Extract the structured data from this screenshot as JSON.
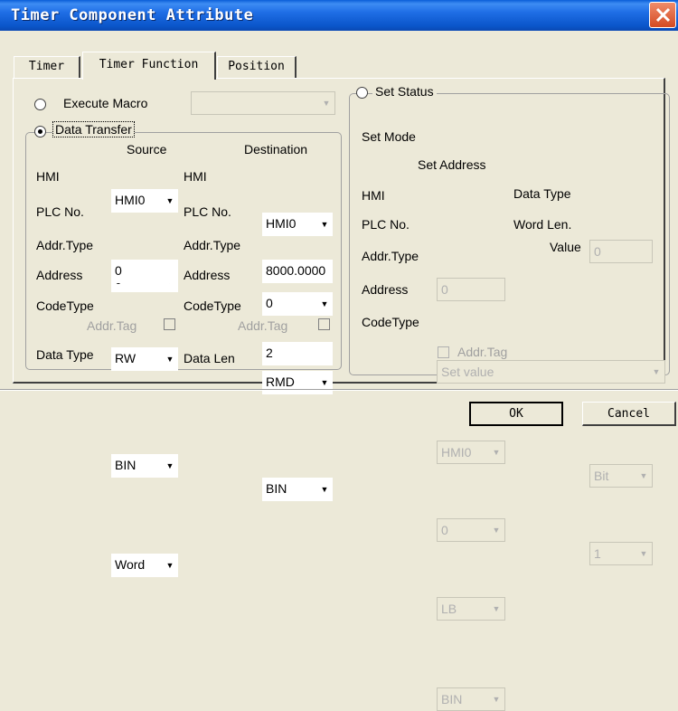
{
  "window": {
    "title": "Timer Component Attribute"
  },
  "tabs": [
    {
      "label": "Timer"
    },
    {
      "label": "Timer Function"
    },
    {
      "label": "Position"
    }
  ],
  "execute_macro": {
    "label": "Execute Macro",
    "value": ""
  },
  "data_transfer": {
    "label": "Data Transfer",
    "source_header": "Source",
    "destination_header": "Destination",
    "hmi_label": "HMI",
    "plc_label": "PLC No.",
    "addr_type_label": "Addr.Type",
    "address_label": "Address",
    "code_type_label": "CodeType",
    "addr_tag_label": "Addr.Tag",
    "data_type_label": "Data Type",
    "data_len_label": "Data Len",
    "source": {
      "hmi": "HMI0",
      "plc_no": "0",
      "addr_type": "RW",
      "address": "0",
      "code_type": "BIN",
      "data_type": "Word"
    },
    "destination": {
      "hmi": "HMI0",
      "plc_no": "0",
      "addr_type": "RMD",
      "address": "8000.0000",
      "code_type": "BIN",
      "data_len": "2"
    }
  },
  "set_status": {
    "label": "Set Status",
    "set_mode_label": "Set Mode",
    "set_mode_value": "Set value",
    "set_address_header": "Set Address",
    "hmi_label": "HMI",
    "hmi_value": "HMI0",
    "data_type_label": "Data Type",
    "data_type_value": "Bit",
    "plc_label": "PLC No.",
    "plc_value": "0",
    "word_len_label": "Word Len.",
    "word_len_value": "1",
    "addr_type_label": "Addr.Type",
    "addr_type_value": "LB",
    "value_label": "Value",
    "value_value": "0",
    "address_label": "Address",
    "address_value": "0",
    "code_type_label": "CodeType",
    "code_type_value": "BIN",
    "addr_tag_label": "Addr.Tag"
  },
  "buttons": {
    "ok": "OK",
    "cancel": "Cancel"
  }
}
